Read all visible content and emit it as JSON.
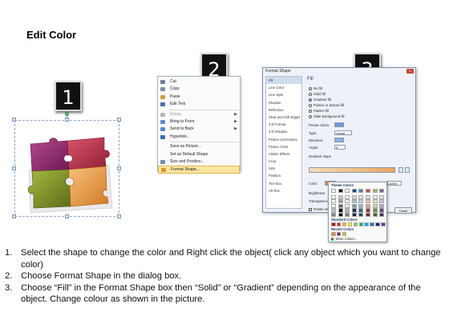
{
  "title": "Edit Color",
  "steps": [
    "1",
    "2",
    "3"
  ],
  "context_menu": {
    "items": [
      {
        "label": "Cut",
        "icon": "scissors-icon",
        "color": "#6b7d9a",
        "disabled": false
      },
      {
        "label": "Copy",
        "icon": "copy-icon",
        "color": "#7d8ea8",
        "disabled": false
      },
      {
        "label": "Paste",
        "icon": "paste-icon",
        "color": "#c8a24a",
        "disabled": false
      },
      {
        "label": "Edit Text",
        "icon": "edit-text-icon",
        "color": "#4a6fa8",
        "disabled": false
      },
      {
        "label": "Group",
        "icon": "group-icon",
        "color": "#b8b8b8",
        "disabled": true,
        "submenu": true
      },
      {
        "label": "Bring to Front",
        "icon": "bring-front-icon",
        "color": "#5a8bc9",
        "disabled": false,
        "submenu": true
      },
      {
        "label": "Send to Back",
        "icon": "send-back-icon",
        "color": "#5a8bc9",
        "disabled": false,
        "submenu": true
      },
      {
        "label": "Hyperlink...",
        "icon": "hyperlink-icon",
        "color": "#3a6bb5",
        "disabled": false
      },
      {
        "label": "Save as Picture...",
        "icon": "",
        "color": "",
        "disabled": false
      },
      {
        "label": "Set as Default Shape",
        "icon": "",
        "color": "",
        "disabled": false
      },
      {
        "label": "Size and Position...",
        "icon": "size-position-icon",
        "color": "#6f8fb8",
        "disabled": false
      },
      {
        "label": "Format Shape...",
        "icon": "format-shape-icon",
        "color": "#d89a2a",
        "disabled": false,
        "highlight": true
      }
    ]
  },
  "format_dialog": {
    "title": "Format Shape",
    "close_label": "x",
    "nav_items": [
      "Fill",
      "Line Color",
      "Line Style",
      "Shadow",
      "Reflection",
      "Glow and Soft Edges",
      "3-D Format",
      "3-D Rotation",
      "Picture Corrections",
      "Picture Color",
      "Artistic Effects",
      "Crop",
      "Size",
      "Position",
      "Text Box",
      "Alt Text"
    ],
    "panel_title": "Fill",
    "fill_options": [
      {
        "label": "No fill",
        "selected": false
      },
      {
        "label": "Solid fill",
        "selected": false
      },
      {
        "label": "Gradient fill",
        "selected": true
      },
      {
        "label": "Picture or texture fill",
        "selected": false
      },
      {
        "label": "Pattern fill",
        "selected": false
      },
      {
        "label": "Slide background fill",
        "selected": false
      }
    ],
    "preset_colors_label": "Preset colors:",
    "type_label": "Type:",
    "type_value": "Linear",
    "direction_label": "Direction:",
    "angle_label": "Angle:",
    "angle_value": "0°",
    "gradient_stops_label": "Gradient stops",
    "color_label": "Color",
    "position_label": "Position:",
    "position_value": "100%",
    "brightness_label": "Brightness",
    "transparency_label": "Transparency",
    "rotate_label": "Rotate with shape",
    "close_button": "Close"
  },
  "color_palette": {
    "theme_label": "Theme Colors",
    "standard_label": "Standard Colors",
    "recent_label": "Recent Colors",
    "more_label": "More Colors...",
    "theme_top": [
      "#ffffff",
      "#000000",
      "#eeece1",
      "#1f497d",
      "#4f81bd",
      "#c0504d",
      "#9bbb59",
      "#8064a2"
    ],
    "standard": [
      "#c00000",
      "#ff0000",
      "#ffc000",
      "#ffff00",
      "#92d050",
      "#00b050",
      "#00b0f0",
      "#0070c0",
      "#002060",
      "#7030a0"
    ],
    "recent": [
      "#e48a37",
      "#7a1f5a",
      "#b2d235"
    ]
  },
  "instructions": [
    {
      "num": "1.",
      "text": "Select the shape to change the color and Right click the object( click any object which you want to change color)"
    },
    {
      "num": "2.",
      "text": "Choose Format Shape in the dialog box."
    },
    {
      "num": "3.",
      "text": "Choose “Fill” in the Format Shape box then “Solid” or “Gradient” depending on the appearance of the object. Change colour as shown in the picture."
    }
  ]
}
